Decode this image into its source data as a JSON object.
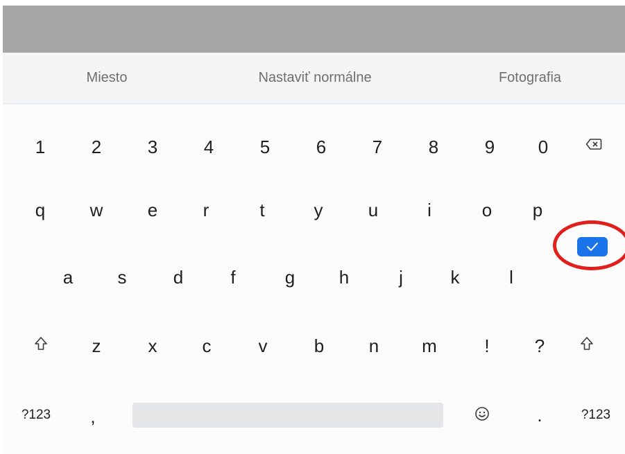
{
  "suggestions": [
    "Miesto",
    "Nastaviť normálne",
    "Fotografia"
  ],
  "rows": {
    "numbers": [
      "1",
      "2",
      "3",
      "4",
      "5",
      "6",
      "7",
      "8",
      "9",
      "0"
    ],
    "row1": [
      "q",
      "w",
      "e",
      "r",
      "t",
      "y",
      "u",
      "i",
      "o",
      "p"
    ],
    "row2": [
      "a",
      "s",
      "d",
      "f",
      "g",
      "h",
      "j",
      "k",
      "l"
    ],
    "row3": [
      "z",
      "x",
      "c",
      "v",
      "b",
      "n",
      "m",
      "!",
      "?"
    ]
  },
  "bottom": {
    "symbols_left": "?123",
    "comma": ",",
    "period": ".",
    "symbols_right": "?123"
  },
  "icons": {
    "backspace": "backspace-icon",
    "shift": "shift-icon",
    "emoji": "emoji-icon",
    "checkmark": "checkmark-icon"
  },
  "colors": {
    "accent": "#1a73e8",
    "annotation": "#e0201f"
  }
}
